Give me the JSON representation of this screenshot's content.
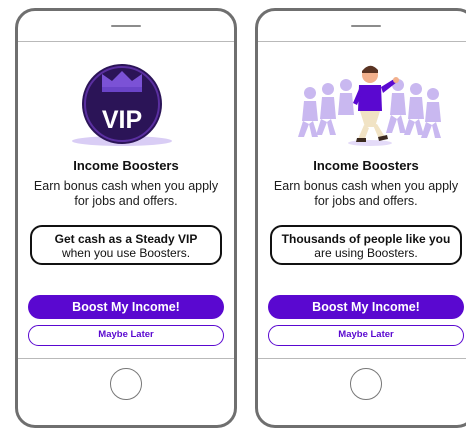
{
  "colors": {
    "accent": "#5a08d0",
    "vip_badge": "#2b1457",
    "crowd": "#c9b8f0"
  },
  "screens": [
    {
      "illustration": "vip-crown-badge",
      "badge_text": "VIP",
      "title": "Income Boosters",
      "description": "Earn bonus cash when you apply for jobs and offers.",
      "callout_bold": "Get cash as a Steady VIP",
      "callout_normal": "when you use Boosters.",
      "primary_button": "Boost My Income!",
      "secondary_button": "Maybe Later"
    },
    {
      "illustration": "person-with-crowd",
      "title": "Income Boosters",
      "description": "Earn bonus cash when you apply for jobs and offers.",
      "callout_bold": "Thousands of people like you",
      "callout_normal": "are using Boosters.",
      "primary_button": "Boost My Income!",
      "secondary_button": "Maybe Later"
    }
  ]
}
